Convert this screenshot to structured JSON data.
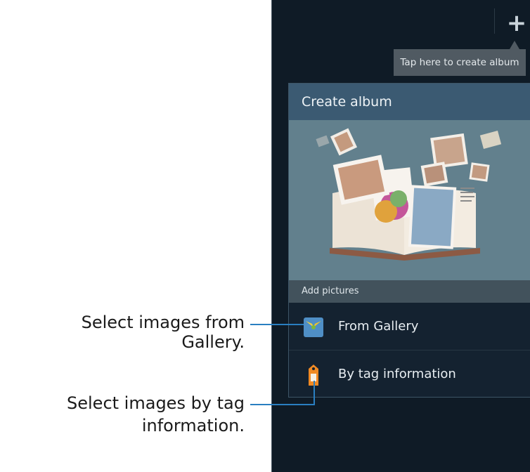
{
  "toolbar": {
    "add_icon": "plus-icon"
  },
  "tooltip": {
    "text": "Tap here to create album"
  },
  "dialog": {
    "title": "Create album",
    "section_label": "Add pictures",
    "options": [
      {
        "label": "From Gallery",
        "icon": "gallery-icon"
      },
      {
        "label": "By tag information",
        "icon": "tag-icon"
      }
    ]
  },
  "callouts": {
    "gallery": "Select images from Gallery.",
    "tag_line1": "Select images by tag",
    "tag_line2": "information."
  },
  "colors": {
    "accent": "#2a7fc1",
    "header": "#3b5a72",
    "background": "#0f1b26"
  }
}
